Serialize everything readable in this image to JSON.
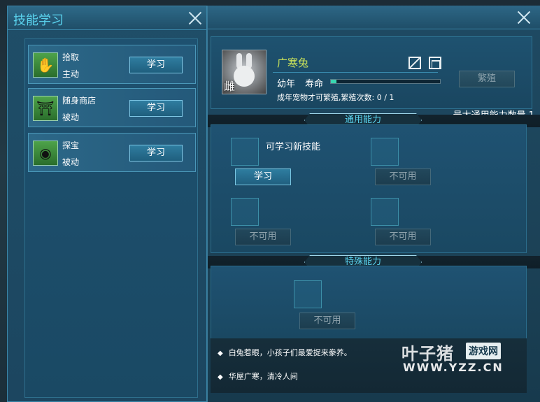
{
  "skill_window": {
    "title": "技能学习",
    "skills": [
      {
        "name": "拾取",
        "type": "主动",
        "button": "学习",
        "icon": "paw-grab-icon"
      },
      {
        "name": "随身商店",
        "type": "被动",
        "button": "学习",
        "icon": "pagoda-icon"
      },
      {
        "name": "探宝",
        "type": "被动",
        "button": "学习",
        "icon": "signal-radar-icon"
      }
    ]
  },
  "pet_window": {
    "pet": {
      "name": "广寒兔",
      "gender": "雌",
      "age": "幼年",
      "life_label": "寿命",
      "life_fraction": 0.05,
      "breed_note": "成年宠物才可繁殖,繁殖次数: 0 / 1",
      "breed_button": "繁殖",
      "name_color": "#c8e05a"
    },
    "max_ability_text": "最大通用能力数量 1",
    "general": {
      "title": "通用能力",
      "new_skill_label": "可学习新技能",
      "slots": [
        {
          "button": "学习",
          "enabled": true
        },
        {
          "button": "不可用",
          "enabled": false
        },
        {
          "button": "不可用",
          "enabled": false
        },
        {
          "button": "不可用",
          "enabled": false
        }
      ]
    },
    "special": {
      "title": "特殊能力",
      "slots": [
        {
          "button": "不可用",
          "enabled": false
        }
      ]
    },
    "descriptions": [
      "白兔惹眼，小孩子们最爱捉来豢养。",
      "华屋广寒，清冷人间"
    ]
  },
  "watermark": {
    "main": "叶子猪",
    "tag": "游戏网",
    "url": "WWW.YZZ.CN"
  },
  "colors": {
    "accent": "#5ad3ee",
    "life_bar": "#39d6b0"
  }
}
